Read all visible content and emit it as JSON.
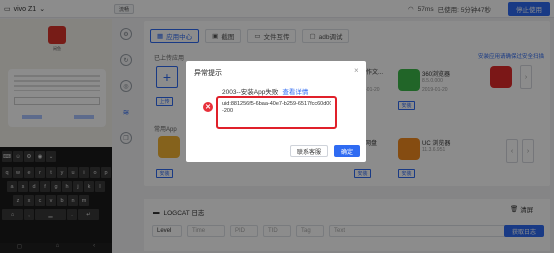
{
  "topbar": {
    "device": "vivo Z1",
    "quality": "流畅",
    "network": "57ms",
    "used_time": "已使用: 5分钟47秒",
    "stop_label": "停止使用"
  },
  "phone": {
    "app_label": "闲鱼",
    "keyboard_rows": [
      [
        "q",
        "w",
        "e",
        "r",
        "t",
        "y",
        "u",
        "i",
        "o",
        "p"
      ],
      [
        "a",
        "s",
        "d",
        "f",
        "g",
        "h",
        "j",
        "k",
        "l"
      ],
      [
        "z",
        "x",
        "c",
        "v",
        "b",
        "n",
        "m"
      ]
    ],
    "nav_icons": [
      "square-icon",
      "home-icon",
      "back-icon"
    ]
  },
  "panel": {
    "tabs": [
      {
        "label": "应用中心",
        "icon": "grid-icon",
        "active": true
      },
      {
        "label": "截图",
        "icon": "image-icon",
        "active": false
      },
      {
        "label": "文件互传",
        "icon": "folder-icon",
        "active": false
      },
      {
        "label": "adb调试",
        "icon": "terminal-icon",
        "active": false
      }
    ],
    "installed_label": "已上传应用",
    "right_link": "安装应用请确保过安全扫描",
    "upload_label": "上传",
    "common_label": "常用App",
    "cards": [
      {
        "name": "保存作文...",
        "meta1": "",
        "meta2": "2019-01-20"
      },
      {
        "name": "360浏览器",
        "meta1": "8.5.0.000",
        "meta2": "2019-01-20"
      },
      {
        "name": "...日网盘",
        "meta1": "",
        "meta2": ""
      },
      {
        "name": "UC 浏览器",
        "meta1": "11.3.6.951",
        "meta2": ""
      }
    ],
    "install_label": "安装"
  },
  "logcat": {
    "title": "LOGCAT 日志",
    "clear_label": "清屏",
    "filters": [
      "Level",
      "Time",
      "PID",
      "TID",
      "Tag",
      "Text"
    ],
    "export_label": "获取日志"
  },
  "modal": {
    "title": "异常提示",
    "message": "2003--安装App失败",
    "link": "查看详情",
    "error_line1": "uid:881256f5-6baa-40e7-b259-6517fcc60d00",
    "error_line2": "-200",
    "support_label": "联系客服",
    "ok_label": "确定"
  },
  "colors": {
    "accent": "#2f6bf2",
    "error": "#e0202a"
  }
}
